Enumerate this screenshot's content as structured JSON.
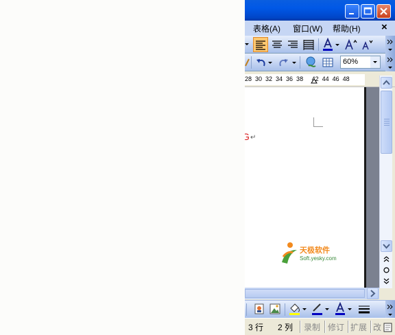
{
  "menu": {
    "items": [
      "表格(A)",
      "窗口(W)",
      "帮助(H)"
    ],
    "close_symbol": "×"
  },
  "toolbar": {
    "zoom_value": "60%"
  },
  "ruler": {
    "numbers": "28  30  32  34  36  38     42  44  46  48"
  },
  "document": {
    "visible_char": "G",
    "paragraph_mark": "↵"
  },
  "logo": {
    "name": "天极软件",
    "url": "Soft.yesky.com"
  },
  "statusbar": {
    "line": "3 行",
    "column": "2 列",
    "record": "录制",
    "revise": "修订",
    "extend": "扩展",
    "overwrite": "改"
  },
  "colors": {
    "title_bar": "#0058e6",
    "menu_bar": "#c6d6f4",
    "highlight": "#ffc870",
    "text_red": "#d81e1e"
  },
  "icons": {
    "minimize": "minimize-icon",
    "maximize": "maximize-icon",
    "close": "close-icon",
    "align_left": "align-left-icon",
    "align_center": "align-center-icon",
    "align_right": "align-right-icon",
    "justify": "justify-icon",
    "font_color": "font-color-icon",
    "grow_font": "grow-font-icon",
    "shrink_font": "shrink-font-icon",
    "undo": "undo-icon",
    "redo": "redo-icon",
    "hyperlink": "hyperlink-icon",
    "table": "table-icon"
  }
}
